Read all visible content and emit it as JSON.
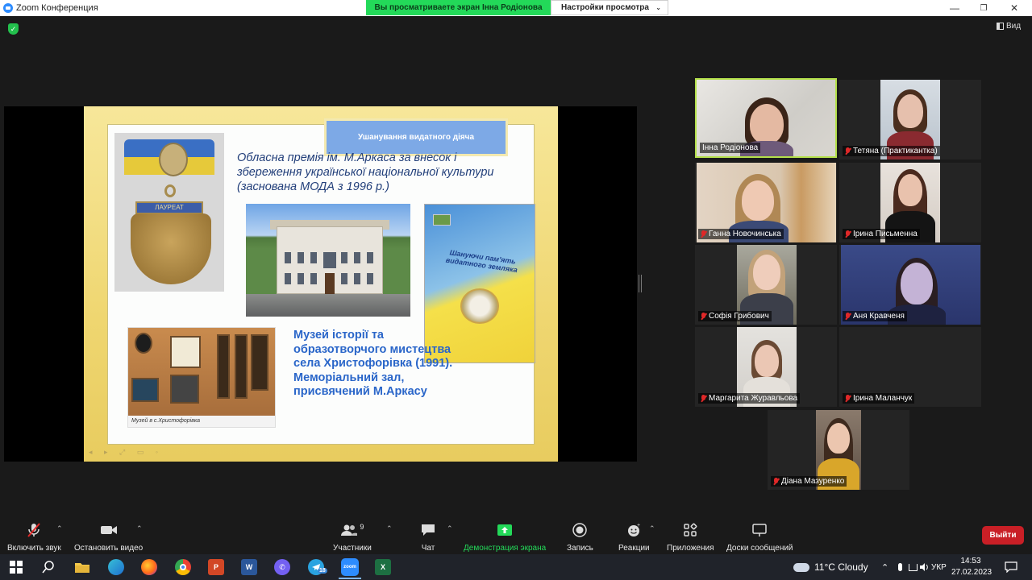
{
  "window": {
    "title": "Zoom Конференция",
    "share_banner": "Вы просматриваете экран Інна Родіонова",
    "view_settings": "Настройки просмотра"
  },
  "top": {
    "view_label": "Вид"
  },
  "slide": {
    "header": "Ушанування видатного діяча",
    "title": "Обласна премія ім. М.Аркаса за внесок і збереження української національної культури (заснована МОДА з 1996 р.)",
    "medal_plate": "ЛАУРЕАТ",
    "book_title": "Шануючи пам'ять видатного земляка",
    "museum_caption": "Музей в с.Христофорівка",
    "museum_text": "Музей історії та образотворчого мистецтва села Христофорівка (1991). Меморіальний зал, присвячений М.Аркасу"
  },
  "participants": [
    {
      "name": "Інна Родіонова",
      "muted": false
    },
    {
      "name": "Тетяна (Практикантка)",
      "muted": true
    },
    {
      "name": "Ганна Новочинська",
      "muted": true
    },
    {
      "name": "Ірина Письменна",
      "muted": true
    },
    {
      "name": "Софія Грибович",
      "muted": true
    },
    {
      "name": "Аня Кравченя",
      "muted": true
    },
    {
      "name": "Маргарита Журавльова",
      "muted": true
    },
    {
      "name": "Ірина Маланчук",
      "muted": true
    },
    {
      "name": "Діана Мазуренко",
      "muted": true
    }
  ],
  "toolbar": {
    "audio": "Включить звук",
    "video": "Остановить видео",
    "participants": "Участники",
    "participants_count": "9",
    "chat": "Чат",
    "share": "Демонстрация экрана",
    "record": "Запись",
    "reactions": "Реакции",
    "apps": "Приложения",
    "whiteboards": "Доски сообщений",
    "leave": "Выйти"
  },
  "taskbar": {
    "weather": "11°C  Cloudy",
    "lang": "УКР",
    "time": "14:53",
    "date": "27.02.2023",
    "telegram_badge": "18"
  },
  "colors": {
    "accent_green": "#23d959",
    "leave_red": "#c91f26",
    "active_border": "#b4e04a",
    "zoom_blue": "#2d8cff"
  }
}
